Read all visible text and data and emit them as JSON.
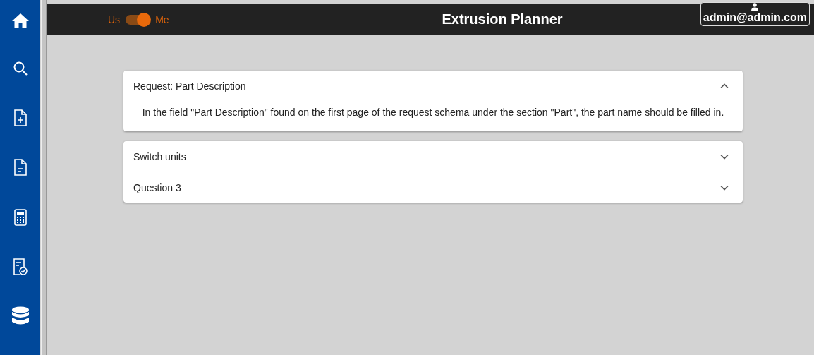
{
  "sidebar": {
    "items": [
      {
        "kind": "home"
      },
      {
        "kind": "search"
      },
      {
        "kind": "file-plus"
      },
      {
        "kind": "file"
      },
      {
        "kind": "calculator"
      },
      {
        "kind": "file-check"
      },
      {
        "kind": "database"
      }
    ]
  },
  "header": {
    "toggle": {
      "left_label": "Us",
      "right_label": "Me",
      "on": true
    },
    "title": "Extrusion Planner",
    "user": "admin@admin.com"
  },
  "accordion": [
    {
      "title": "Request: Part Description",
      "expanded": true,
      "body": "In the field \"Part Description\" found on the first page of the request schema under the section \"Part\", the part name should be filled in."
    },
    {
      "title": "Switch units",
      "expanded": false
    },
    {
      "title": "Question 3",
      "expanded": false
    }
  ]
}
